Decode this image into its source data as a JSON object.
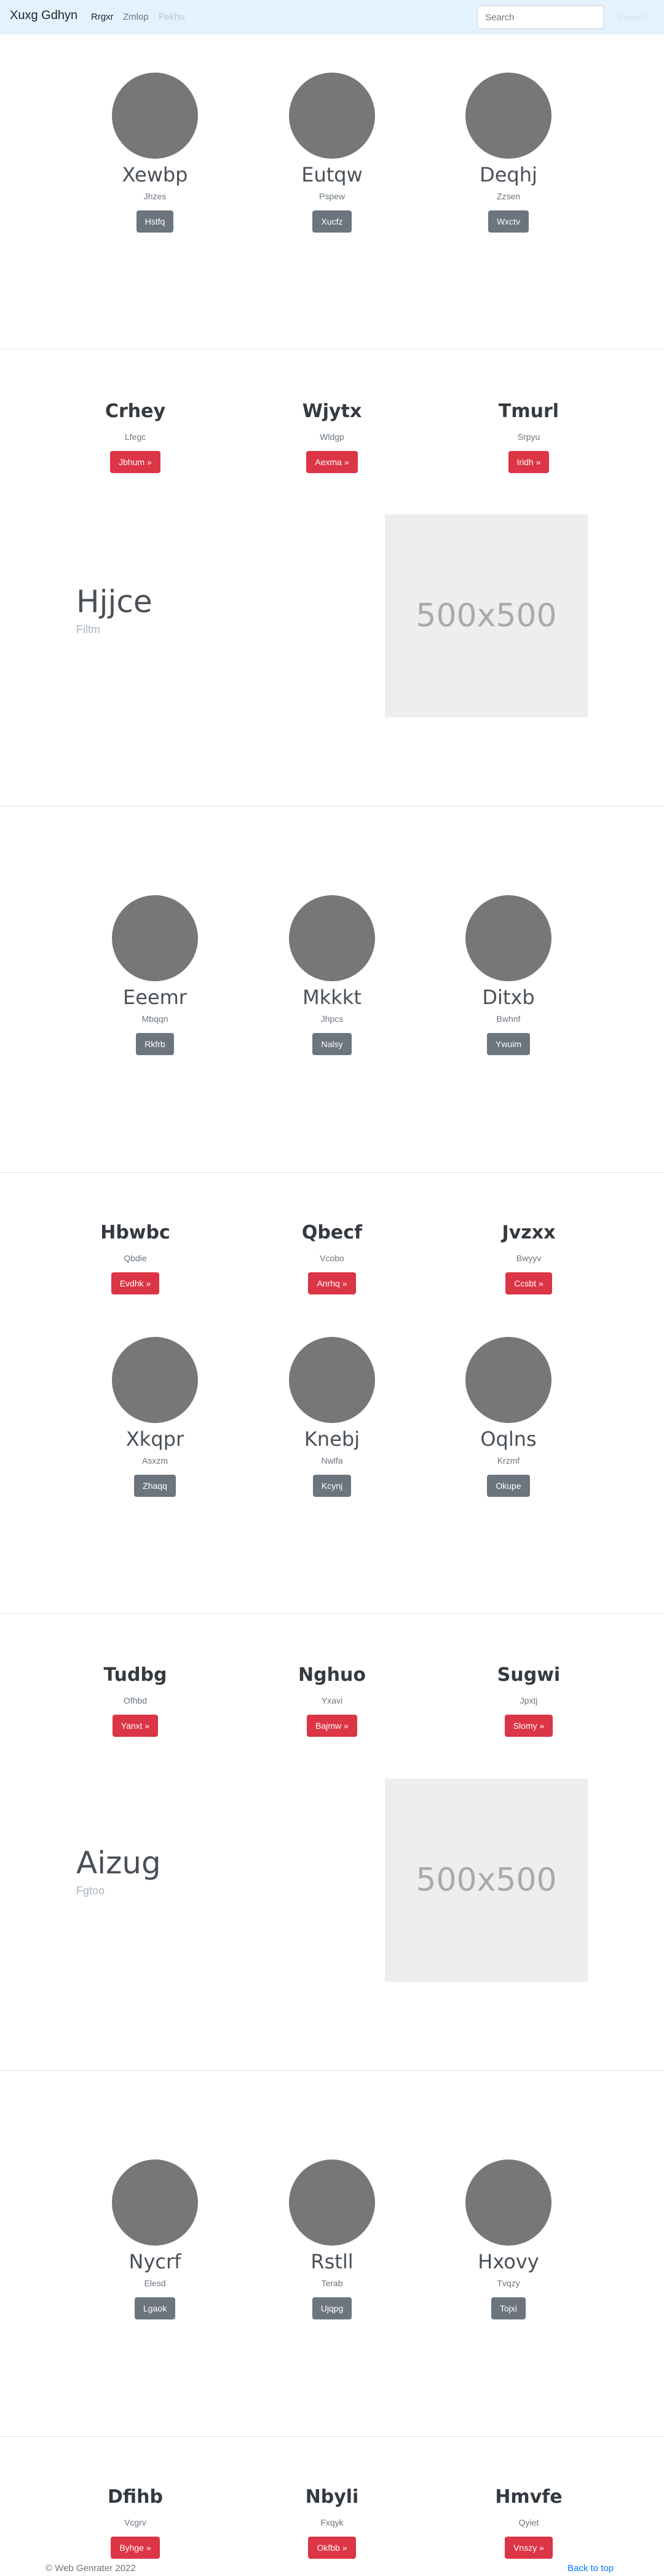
{
  "navbar": {
    "brand": "Xuxg Gdhyn",
    "links": [
      "Rrgxr",
      "Zmlop",
      "Pekhu"
    ],
    "search_placeholder": "Search",
    "search_button": "Search"
  },
  "sections": {
    "team1": [
      {
        "name": "Xewbp",
        "role": "Jhzes",
        "button": "Hstfq"
      },
      {
        "name": "Eutqw",
        "role": "Pspew",
        "button": "Xucfz"
      },
      {
        "name": "Deqhj",
        "role": "Zzsen",
        "button": "Wxctv"
      }
    ],
    "features1": [
      {
        "title": "Crhey",
        "text": "Lfegc",
        "button": "Jbhum »"
      },
      {
        "title": "Wjytx",
        "text": "Wldgp",
        "button": "Aexma »"
      },
      {
        "title": "Tmurl",
        "text": "Srpyu",
        "button": "Iridh »"
      }
    ],
    "featurette1": {
      "title": "Hjjce",
      "subtitle": "Filtm",
      "image_label": "500x500"
    },
    "team2": [
      {
        "name": "Eeemr",
        "role": "Mbqqn",
        "button": "Rkfrb"
      },
      {
        "name": "Mkkkt",
        "role": "Jhpcs",
        "button": "Nalsy"
      },
      {
        "name": "Ditxb",
        "role": "Bwhnf",
        "button": "Ywuim"
      }
    ],
    "features2": [
      {
        "title": "Hbwbc",
        "text": "Qbdie",
        "button": "Evdhk »"
      },
      {
        "title": "Qbecf",
        "text": "Vcobo",
        "button": "Anrhq »"
      },
      {
        "title": "Jvzxx",
        "text": "Bwyyv",
        "button": "Ccsbt »"
      }
    ],
    "team3": [
      {
        "name": "Xkqpr",
        "role": "Asxzm",
        "button": "Zhaqq"
      },
      {
        "name": "Knebj",
        "role": "Nwlfa",
        "button": "Kcynj"
      },
      {
        "name": "Oqlns",
        "role": "Krzmf",
        "button": "Okupe"
      }
    ],
    "features3": [
      {
        "title": "Tudbg",
        "text": "Ofhbd",
        "button": "Yanxt »"
      },
      {
        "title": "Nghuo",
        "text": "Yxavi",
        "button": "Bajmw »"
      },
      {
        "title": "Sugwi",
        "text": "Jpxtj",
        "button": "Slomy »"
      }
    ],
    "featurette2": {
      "title": "Aizug",
      "subtitle": "Fgtoo",
      "image_label": "500x500"
    },
    "team4": [
      {
        "name": "Nycrf",
        "role": "Elesd",
        "button": "Lgaok"
      },
      {
        "name": "Rstll",
        "role": "Terab",
        "button": "Ujqpg"
      },
      {
        "name": "Hxovy",
        "role": "Tvqzy",
        "button": "Tojxi"
      }
    ],
    "features4": [
      {
        "title": "Dfihb",
        "text": "Vcgrv",
        "button": "Byhge »"
      },
      {
        "title": "Nbyli",
        "text": "Fxqyk",
        "button": "Okfbb »"
      },
      {
        "title": "Hmvfe",
        "text": "Qyiet",
        "button": "Vnszy »"
      }
    ]
  },
  "footer": {
    "copyright": "© Web Genrater 2022",
    "back_to_top": "Back to top"
  },
  "colors": {
    "navbar_bg": "#e3f2fd",
    "danger": "#dc3545",
    "secondary": "#6c757d",
    "avatar": "#777777",
    "link": "#007bff"
  }
}
